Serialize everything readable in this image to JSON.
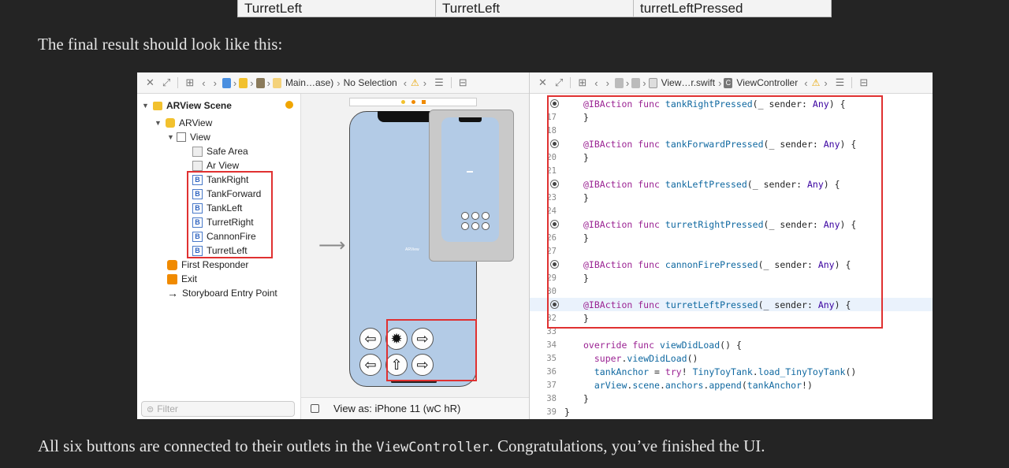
{
  "top_table": {
    "cells": [
      "TurretLeft",
      "TurretLeft",
      "turretLeftPressed"
    ]
  },
  "para_top": "The final result should look like this:",
  "para_bottom": {
    "before": "All six buttons are connected to their outlets in the ",
    "code": "ViewController",
    "after": ". Congratulations, you’ve finished the UI."
  },
  "xcode": {
    "left_toolbar": {
      "file": "Main…ase)",
      "selection": "No Selection"
    },
    "right_toolbar": {
      "file": "View…r.swift",
      "class": "ViewController"
    },
    "outline": {
      "scene": "ARView Scene",
      "arview": "ARView",
      "view": "View",
      "safe_area": "Safe Area",
      "ar_view": "Ar View",
      "buttons": [
        "TankRight",
        "TankForward",
        "TankLeft",
        "TurretRight",
        "CannonFire",
        "TurretLeft"
      ],
      "button_badge": "B",
      "first_responder": "First Responder",
      "exit": "Exit",
      "entry_point": "Storyboard Entry Point"
    },
    "filter_placeholder": "Filter",
    "canvas": {
      "phone_label": "ARView",
      "view_as": "View as: iPhone 11 (wC hR)"
    },
    "code": {
      "lines": [
        {
          "n": "",
          "dot": true,
          "text": "@IBAction func tankRightPressed(_ sender: Any) {"
        },
        {
          "n": "17",
          "dot": false,
          "text": "}"
        },
        {
          "n": "18",
          "dot": false,
          "text": ""
        },
        {
          "n": "",
          "dot": true,
          "text": "@IBAction func tankForwardPressed(_ sender: Any) {"
        },
        {
          "n": "20",
          "dot": false,
          "text": "}"
        },
        {
          "n": "21",
          "dot": false,
          "text": ""
        },
        {
          "n": "",
          "dot": true,
          "text": "@IBAction func tankLeftPressed(_ sender: Any) {"
        },
        {
          "n": "23",
          "dot": false,
          "text": "}"
        },
        {
          "n": "24",
          "dot": false,
          "text": ""
        },
        {
          "n": "",
          "dot": true,
          "text": "@IBAction func turretRightPressed(_ sender: Any) {"
        },
        {
          "n": "26",
          "dot": false,
          "text": "}"
        },
        {
          "n": "27",
          "dot": false,
          "text": ""
        },
        {
          "n": "",
          "dot": true,
          "text": "@IBAction func cannonFirePressed(_ sender: Any) {"
        },
        {
          "n": "29",
          "dot": false,
          "text": "}"
        },
        {
          "n": "30",
          "dot": false,
          "text": ""
        },
        {
          "n": "",
          "dot": true,
          "text": "@IBAction func turretLeftPressed(_ sender: Any) {"
        },
        {
          "n": "32",
          "dot": false,
          "text": "}"
        },
        {
          "n": "33",
          "dot": false,
          "text": ""
        },
        {
          "n": "34",
          "dot": false,
          "text": "override func viewDidLoad() {"
        },
        {
          "n": "35",
          "dot": false,
          "text": "  super.viewDidLoad()"
        },
        {
          "n": "36",
          "dot": false,
          "text": "  tankAnchor = try! TinyToyTank.load_TinyToyTank()"
        },
        {
          "n": "37",
          "dot": false,
          "text": "  arView.scene.anchors.append(tankAnchor!)"
        },
        {
          "n": "38",
          "dot": false,
          "text": "}"
        },
        {
          "n": "39",
          "dot": false,
          "text": "}"
        }
      ]
    }
  },
  "colors": {
    "page_bg": "#242424",
    "highlight": "#e03131",
    "phone_blue": "#b3cbe6",
    "keyword": "#9b2393",
    "function": "#0f68a0"
  }
}
